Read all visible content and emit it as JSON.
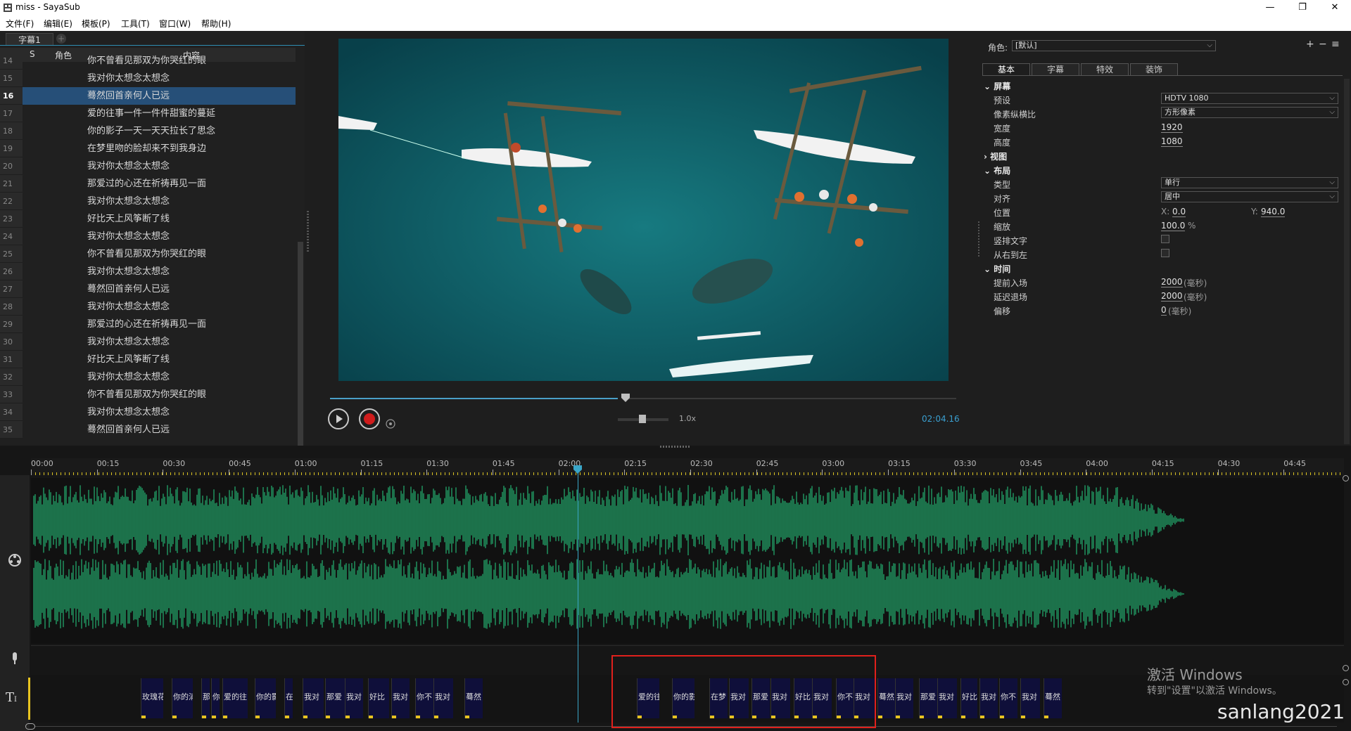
{
  "window": {
    "title": "miss - SayaSub",
    "controls": {
      "minimize": "—",
      "restore": "❐",
      "close": "✕"
    }
  },
  "menu": [
    "文件(F)",
    "编辑(E)",
    "模板(P)",
    "工具(T)",
    "窗口(W)",
    "帮助(H)"
  ],
  "subtitle_panel": {
    "tab": "字幕1",
    "add_tab": "+",
    "headers": {
      "s": "S",
      "role": "角色",
      "content": "内容"
    },
    "rows": [
      {
        "num": "14",
        "text": "你不曾看见那双为你哭红的眼"
      },
      {
        "num": "15",
        "text": "我对你太想念太想念"
      },
      {
        "num": "16",
        "text": "蓦然回首亲何人已远"
      },
      {
        "num": "17",
        "text": "爱的往事一件一件件甜蜜的蔓延"
      },
      {
        "num": "18",
        "text": "你的影子一天一天天拉长了思念"
      },
      {
        "num": "19",
        "text": "在梦里吻的脸却来不到我身边"
      },
      {
        "num": "20",
        "text": "我对你太想念太想念"
      },
      {
        "num": "21",
        "text": "那爱过的心还在祈祷再见一面"
      },
      {
        "num": "22",
        "text": "我对你太想念太想念"
      },
      {
        "num": "23",
        "text": "好比天上风筝断了线"
      },
      {
        "num": "24",
        "text": "我对你太想念太想念"
      },
      {
        "num": "25",
        "text": "你不曾看见那双为你哭红的眼"
      },
      {
        "num": "26",
        "text": "我对你太想念太想念"
      },
      {
        "num": "27",
        "text": "蓦然回首亲何人已远"
      },
      {
        "num": "28",
        "text": "我对你太想念太想念"
      },
      {
        "num": "29",
        "text": "那爱过的心还在祈祷再见一面"
      },
      {
        "num": "30",
        "text": "我对你太想念太想念"
      },
      {
        "num": "31",
        "text": "好比天上风筝断了线"
      },
      {
        "num": "32",
        "text": "我对你太想念太想念"
      },
      {
        "num": "33",
        "text": "你不曾看见那双为你哭红的眼"
      },
      {
        "num": "34",
        "text": "我对你太想念太想念"
      },
      {
        "num": "35",
        "text": "蓦然回首亲何人已远"
      }
    ],
    "selected_row": "16"
  },
  "player": {
    "speed": "1.0x",
    "time": "02:04.16",
    "progress": 0.46
  },
  "properties": {
    "role_label": "角色:",
    "role_value": "[默认]",
    "toolbar": {
      "add": "+",
      "remove": "−",
      "list": "≡"
    },
    "tabs": [
      "基本",
      "字幕",
      "特效",
      "装饰"
    ],
    "active_tab": "基本",
    "screen": {
      "section": "屏幕",
      "preset_label": "预设",
      "preset_value": "HDTV 1080",
      "ratio_label": "像素纵横比",
      "ratio_value": "方形像素",
      "width_label": "宽度",
      "width_value": "1920",
      "height_label": "高度",
      "height_value": "1080"
    },
    "view": {
      "section": "视图"
    },
    "layout": {
      "section": "布局",
      "type_label": "类型",
      "type_value": "单行",
      "align_label": "对齐",
      "align_value": "居中",
      "pos_label": "位置",
      "pos_x_prefix": "X:",
      "pos_x": "0.0",
      "pos_y_prefix": "Y:",
      "pos_y": "940.0",
      "scale_label": "缩放",
      "scale_value": "100.0",
      "scale_unit": "%",
      "vertical_label": "竖排文字",
      "rtl_label": "从右到左"
    },
    "time": {
      "section": "时间",
      "lead_in_label": "提前入场",
      "lead_in_value": "2000",
      "lead_in_unit": "(毫秒)",
      "lead_out_label": "延迟退场",
      "lead_out_value": "2000",
      "lead_out_unit": "(毫秒)",
      "offset_label": "偏移",
      "offset_value": "0",
      "offset_unit": "(毫秒)"
    }
  },
  "timeline": {
    "ticks": [
      "00:00",
      "00:15",
      "00:30",
      "00:45",
      "01:00",
      "01:15",
      "01:30",
      "01:45",
      "02:00",
      "02:15",
      "02:30",
      "02:45",
      "03:00",
      "03:15",
      "03:30",
      "03:45",
      "04:00",
      "04:15",
      "04:30",
      "04:45"
    ],
    "clips": [
      {
        "text": "玫瑰花"
      },
      {
        "text": "你的浦"
      },
      {
        "text": "那"
      },
      {
        "text": "你"
      },
      {
        "text": "爱的往"
      },
      {
        "text": "你的影"
      },
      {
        "text": "在"
      },
      {
        "text": "我对"
      },
      {
        "text": "那爱"
      },
      {
        "text": "我对"
      },
      {
        "text": "好比"
      },
      {
        "text": "我对"
      },
      {
        "text": "你不"
      },
      {
        "text": "我对"
      },
      {
        "text": "蓦然"
      },
      {
        "text": "爱的往"
      },
      {
        "text": "你的影"
      },
      {
        "text": "在梦"
      },
      {
        "text": "我对"
      },
      {
        "text": "那爱"
      },
      {
        "text": "我对"
      },
      {
        "text": "好比"
      },
      {
        "text": "我对"
      },
      {
        "text": "你不"
      },
      {
        "text": "我对"
      },
      {
        "text": "蓦然"
      },
      {
        "text": "我对"
      },
      {
        "text": "那爱"
      },
      {
        "text": "我对"
      },
      {
        "text": "好比"
      },
      {
        "text": "我对"
      },
      {
        "text": "你不"
      },
      {
        "text": "我对"
      },
      {
        "text": "蓦然"
      }
    ]
  },
  "overlay": {
    "activate_title": "激活 Windows",
    "activate_sub": "转到\"设置\"以激活 Windows。",
    "watermark": "sanlang2021"
  }
}
